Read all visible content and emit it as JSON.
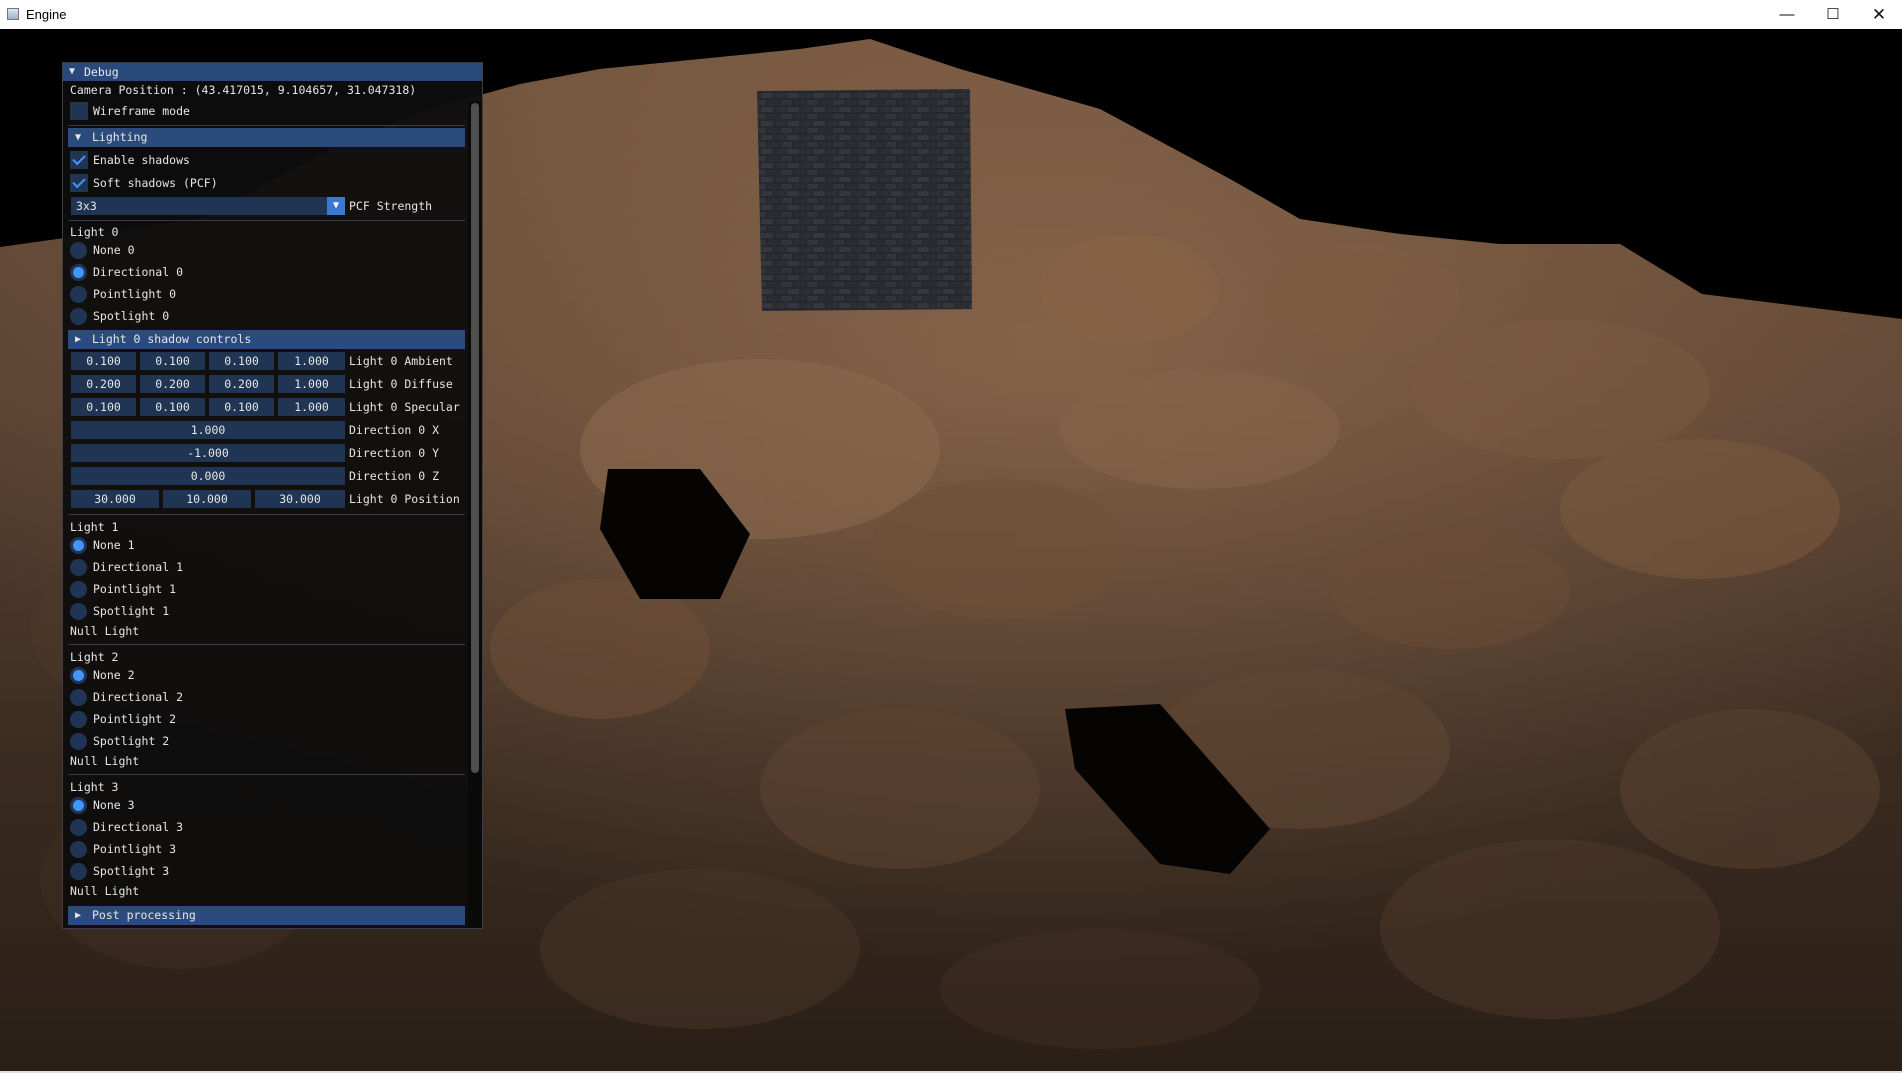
{
  "window": {
    "title": "Engine",
    "minimize": "—",
    "maximize": "☐",
    "close": "✕"
  },
  "debug": {
    "title": "Debug",
    "camera_position": "Camera Position : (43.417015, 9.104657, 31.047318)",
    "wireframe_label": "Wireframe mode",
    "wireframe_checked": false,
    "lighting": {
      "header": "Lighting",
      "enable_shadows": "Enable shadows",
      "soft_shadows": "Soft shadows (PCF)",
      "pcf_value": "3x3",
      "pcf_label": "PCF Strength"
    },
    "light0": {
      "title": "Light 0",
      "options": [
        "None 0",
        "Directional 0",
        "Pointlight 0",
        "Spotlight 0"
      ],
      "selected": 1,
      "shadow_controls": "Light 0 shadow controls",
      "ambient": {
        "values": [
          "0.100",
          "0.100",
          "0.100",
          "1.000"
        ],
        "label": "Light 0 Ambient"
      },
      "diffuse": {
        "values": [
          "0.200",
          "0.200",
          "0.200",
          "1.000"
        ],
        "label": "Light 0 Diffuse"
      },
      "specular": {
        "values": [
          "0.100",
          "0.100",
          "0.100",
          "1.000"
        ],
        "label": "Light 0 Specular"
      },
      "dir_x": {
        "value": "1.000",
        "label": "Direction 0 X"
      },
      "dir_y": {
        "value": "-1.000",
        "label": "Direction 0 Y"
      },
      "dir_z": {
        "value": "0.000",
        "label": "Direction 0 Z"
      },
      "position": {
        "values": [
          "30.000",
          "10.000",
          "30.000"
        ],
        "label": "Light 0 Position"
      }
    },
    "light1": {
      "title": "Light 1",
      "options": [
        "None 1",
        "Directional 1",
        "Pointlight 1",
        "Spotlight 1"
      ],
      "selected": 0,
      "status": "Null Light"
    },
    "light2": {
      "title": "Light 2",
      "options": [
        "None 2",
        "Directional 2",
        "Pointlight 2",
        "Spotlight 2"
      ],
      "selected": 0,
      "status": "Null Light"
    },
    "light3": {
      "title": "Light 3",
      "options": [
        "None 3",
        "Directional 3",
        "Pointlight 3",
        "Spotlight 3"
      ],
      "selected": 0,
      "status": "Null Light"
    },
    "post_processing": "Post processing"
  },
  "colors": {
    "header": "#2a4b7c",
    "title": "#29497a",
    "frame": "#203553",
    "accent": "#4296fa"
  }
}
